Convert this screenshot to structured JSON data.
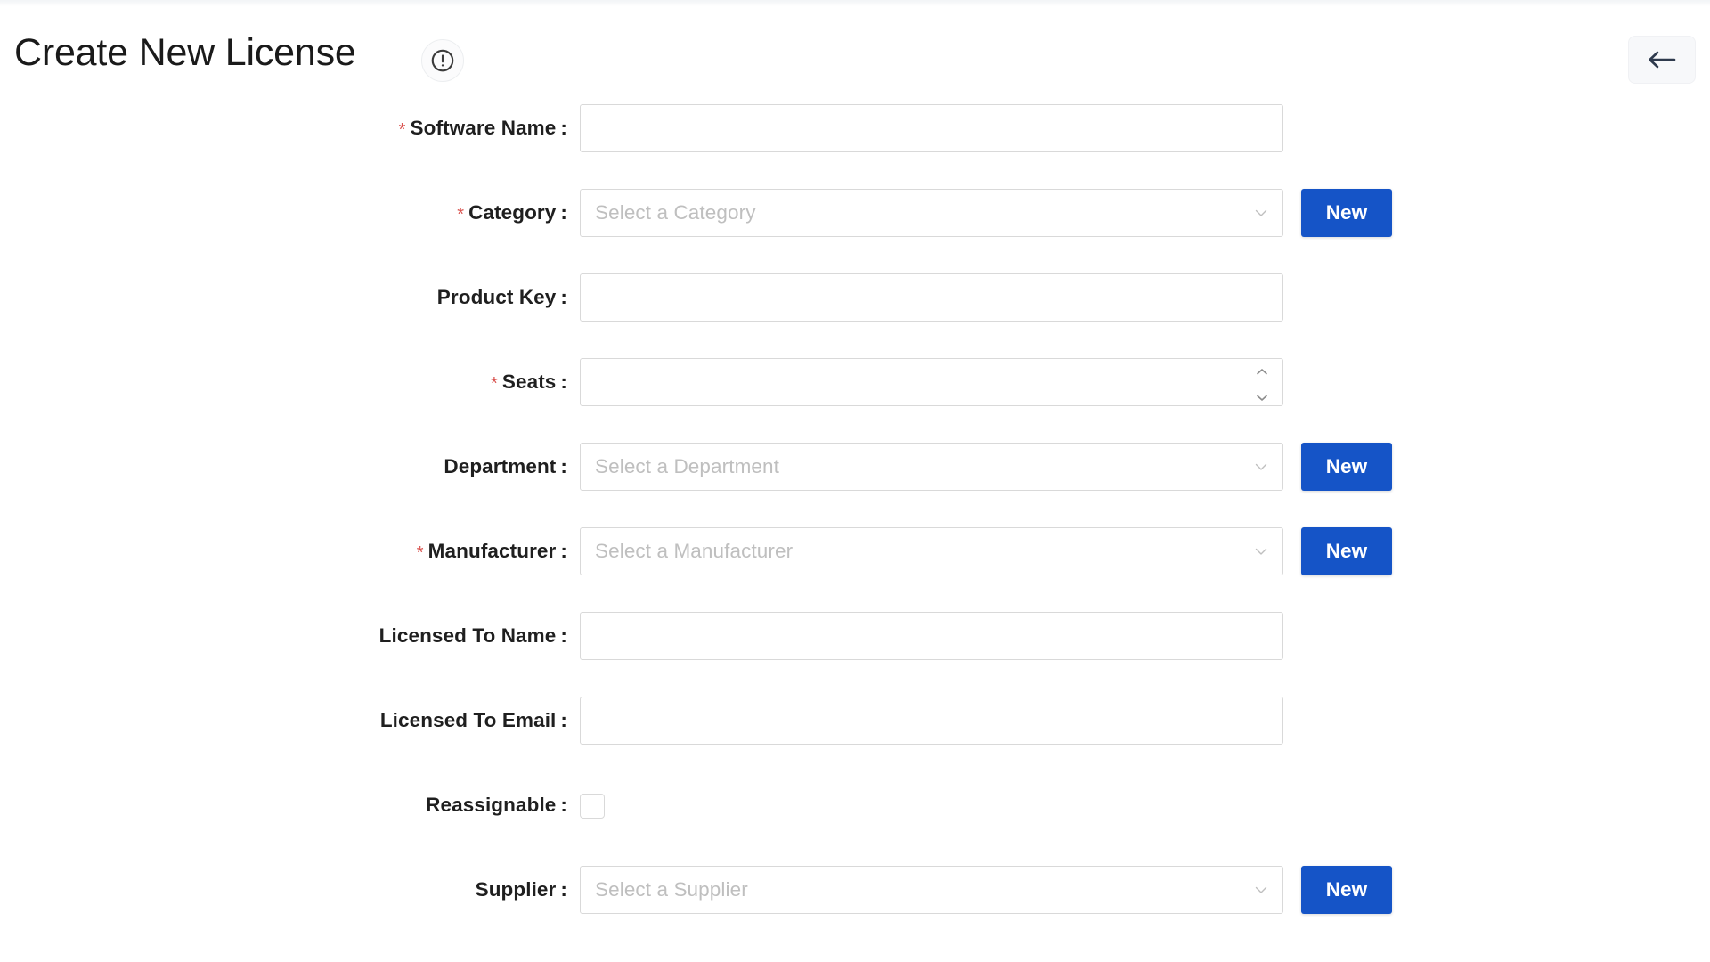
{
  "header": {
    "title": "Create New License",
    "info_icon": "exclamation-circle-icon",
    "back_icon": "arrow-left-icon"
  },
  "buttons": {
    "new_label": "New"
  },
  "colors": {
    "accent_blue": "#1554c7",
    "required_star": "#d9534f",
    "placeholder_text": "#bfbfbf",
    "field_border": "#d9d9d9",
    "label_text": "#1f1f1f",
    "page_background": "#ffffff"
  },
  "form": {
    "required_marker": "*",
    "colon": ":",
    "fields": [
      {
        "key": "software_name",
        "label": "Software Name",
        "required": true,
        "type": "text",
        "value": "",
        "placeholder": "",
        "has_new_button": false
      },
      {
        "key": "category",
        "label": "Category",
        "required": true,
        "type": "select",
        "value": "",
        "placeholder": "Select a Category",
        "has_new_button": true
      },
      {
        "key": "product_key",
        "label": "Product Key",
        "required": false,
        "type": "text",
        "value": "",
        "placeholder": "",
        "has_new_button": false
      },
      {
        "key": "seats",
        "label": "Seats",
        "required": true,
        "type": "number",
        "value": "",
        "placeholder": "",
        "has_new_button": false
      },
      {
        "key": "department",
        "label": "Department",
        "required": false,
        "type": "select",
        "value": "",
        "placeholder": "Select a Department",
        "has_new_button": true
      },
      {
        "key": "manufacturer",
        "label": "Manufacturer",
        "required": true,
        "type": "select",
        "value": "",
        "placeholder": "Select a Manufacturer",
        "has_new_button": true
      },
      {
        "key": "licensed_to_name",
        "label": "Licensed To Name",
        "required": false,
        "type": "text",
        "value": "",
        "placeholder": "",
        "has_new_button": false
      },
      {
        "key": "licensed_to_email",
        "label": "Licensed To Email",
        "required": false,
        "type": "text",
        "value": "",
        "placeholder": "",
        "has_new_button": false
      },
      {
        "key": "reassignable",
        "label": "Reassignable",
        "required": false,
        "type": "checkbox",
        "value": "unchecked",
        "placeholder": "",
        "has_new_button": false
      },
      {
        "key": "supplier",
        "label": "Supplier",
        "required": false,
        "type": "select",
        "value": "",
        "placeholder": "Select a Supplier",
        "has_new_button": true
      }
    ]
  }
}
